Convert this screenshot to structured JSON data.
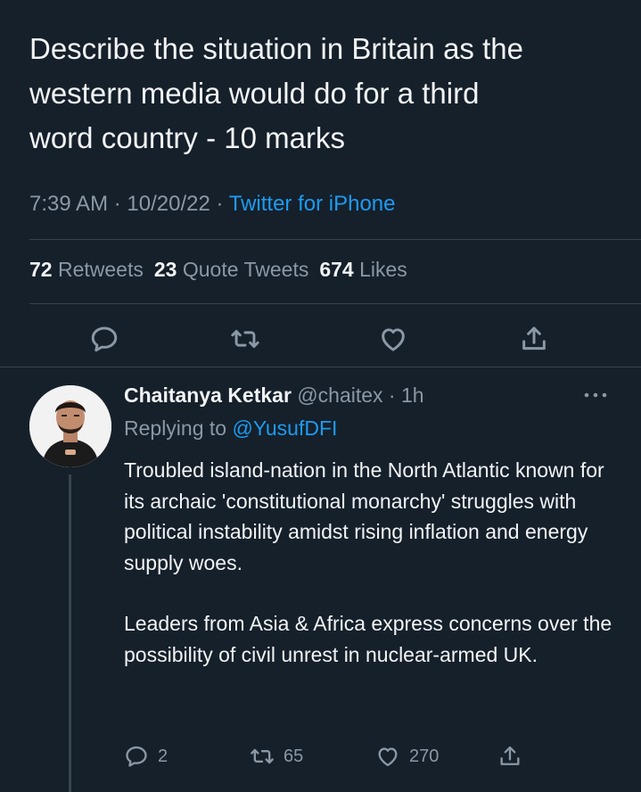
{
  "tweet": {
    "text": "Describe the situation in Britain as the\nwestern media would do for a third\nword country - 10 marks",
    "time": "7:39 AM",
    "date": "10/20/22",
    "source": "Twitter for iPhone",
    "stats": {
      "retweets_count": "72",
      "retweets_label": "Retweets",
      "quotes_count": "23",
      "quotes_label": "Quote Tweets",
      "likes_count": "674",
      "likes_label": "Likes"
    },
    "actions": [
      "reply-icon",
      "retweet-icon",
      "like-icon",
      "share-icon"
    ]
  },
  "reply": {
    "name": "Chaitanya Ketkar",
    "handle": "@chaitex",
    "time": "1h",
    "replying_label": "Replying to",
    "replying_to": "@YusufDFI",
    "paragraph1": "Troubled island-nation in the North Atlantic known for its archaic 'constitutional monarchy' struggles with political instability amidst rising inflation and energy supply woes.",
    "paragraph2": "Leaders from Asia & Africa express concerns over the possibility of civil unrest in nuclear-armed UK.",
    "counts": {
      "replies": "2",
      "retweets": "65",
      "likes": "270"
    }
  },
  "colors": {
    "background": "#15202b",
    "accent": "#1d9bf0",
    "muted": "#8b98a5",
    "divider": "#38444d"
  }
}
